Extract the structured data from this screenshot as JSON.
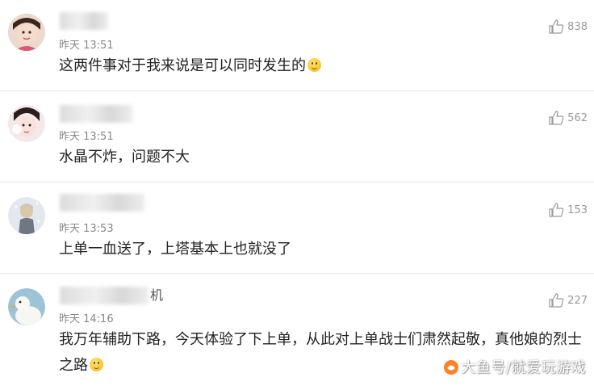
{
  "comments": [
    {
      "name_suffix": "",
      "time": "昨天 13:51",
      "text": "这两件事对于我来说是可以同时发生的",
      "likes": "838",
      "emoji": true
    },
    {
      "name_suffix": "",
      "time": "昨天 13:51",
      "text": "水晶不炸，问题不大",
      "likes": "562",
      "emoji": false
    },
    {
      "name_suffix": "",
      "time": "昨天 13:53",
      "text": "上单一血送了，上塔基本上也就没了",
      "likes": "153",
      "emoji": false
    },
    {
      "name_suffix": "机",
      "time": "昨天 14:16",
      "text": "我万年辅助下路，今天体验了下上单，从此对上单战士们肃然起敬，真他娘的烈士之路",
      "likes": "227",
      "emoji": true
    }
  ],
  "watermark": "大鱼号/就爱玩游戏",
  "colors": {
    "text": "#222222",
    "time": "#888888",
    "like": "#999999",
    "divider": "#e6e6e6",
    "watermark_logo": "#ff6a00"
  },
  "icons": [
    "thumbs-up-icon",
    "smile-emoji-icon",
    "watermark-logo-icon"
  ]
}
